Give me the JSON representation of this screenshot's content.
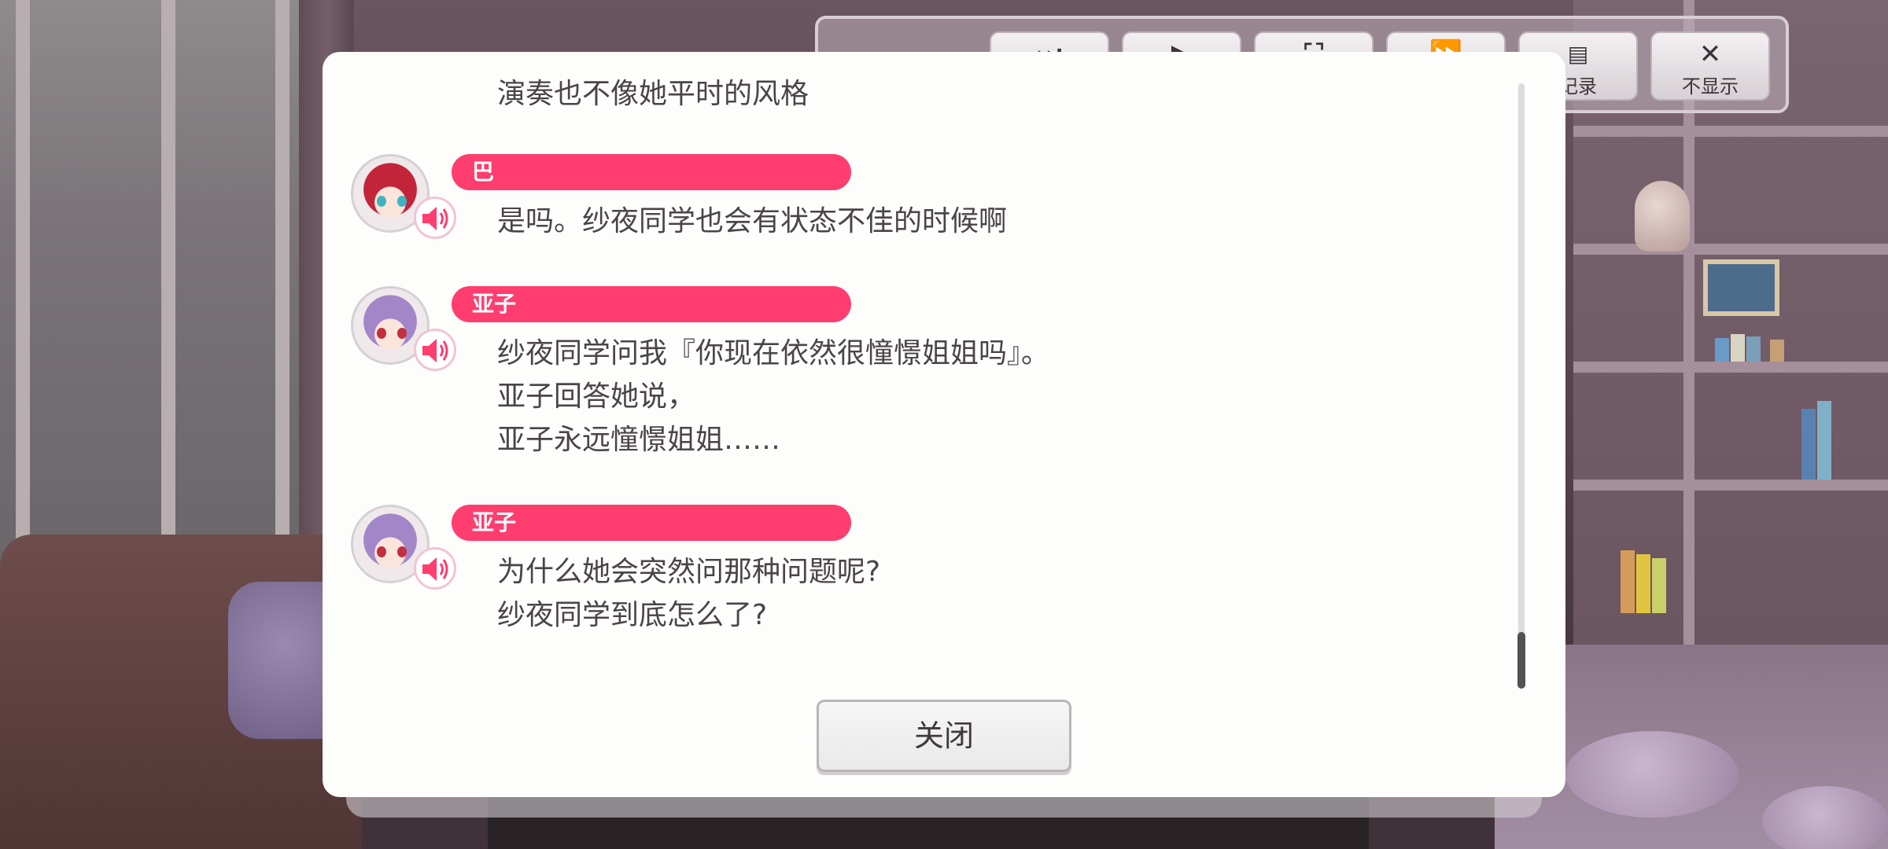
{
  "toolbar": {
    "buttons": [
      {
        "label": "",
        "icon": "skip-icon"
      },
      {
        "label": "",
        "icon": "play-icon"
      },
      {
        "label": "",
        "icon": "fullscreen-icon"
      },
      {
        "label": "",
        "icon": "fast-forward-icon"
      },
      {
        "label": "记录",
        "icon": "log-icon"
      },
      {
        "label": "不显示",
        "icon": "close-icon"
      }
    ]
  },
  "log": {
    "partial_top_line": "演奏也不像她平时的风格",
    "entries": [
      {
        "speaker": "巴",
        "avatar_color": "#c2243a",
        "lines": [
          "是吗。纱夜同学也会有状态不佳的时候啊"
        ]
      },
      {
        "speaker": "亚子",
        "avatar_color": "#a386c8",
        "lines": [
          "纱夜同学问我『你现在依然很憧憬姐姐吗』。",
          "亚子回答她说，",
          "亚子永远憧憬姐姐……"
        ]
      },
      {
        "speaker": "亚子",
        "avatar_color": "#a386c8",
        "lines": [
          "为什么她会突然问那种问题呢?",
          "纱夜同学到底怎么了?"
        ]
      }
    ],
    "close_label": "关闭"
  },
  "colors": {
    "name_bar": "#ff3d6e",
    "dialog_bg": "#fdfdfc",
    "text": "#4a4448"
  }
}
